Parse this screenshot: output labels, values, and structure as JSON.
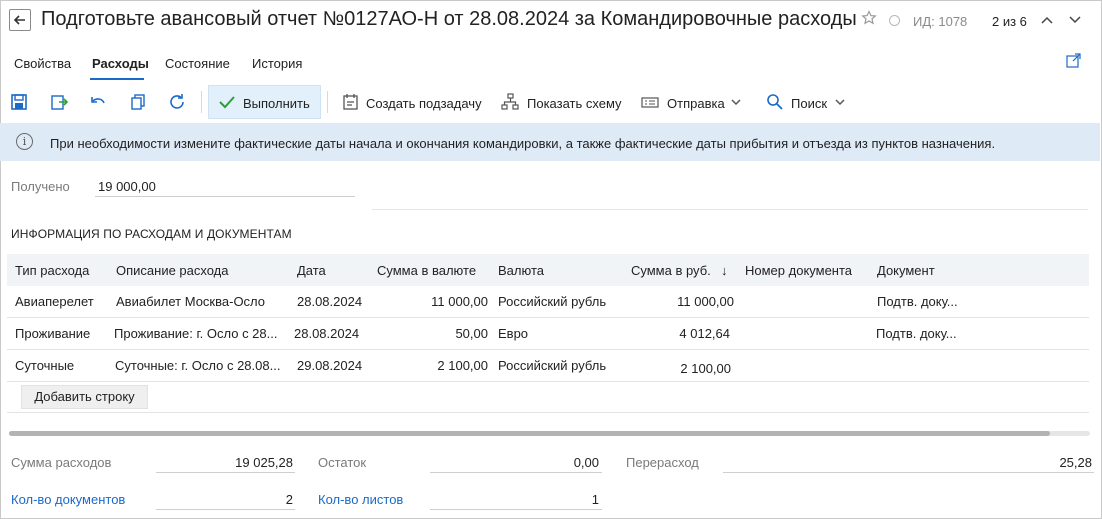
{
  "header": {
    "title": "Подготовьте авансовый отчет №0127АО-Н от 28.08.2024 за Командировочные расходы",
    "id_label": "ИД: 1078",
    "pager": "2 из 6"
  },
  "tabs": [
    {
      "label": "Свойства"
    },
    {
      "label": "Расходы"
    },
    {
      "label": "Состояние"
    },
    {
      "label": "История"
    }
  ],
  "toolbar": {
    "execute_label": "Выполнить",
    "create_subtask_label": "Создать подзадачу",
    "show_scheme_label": "Показать схему",
    "send_label": "Отправка",
    "search_label": "Поиск"
  },
  "info": {
    "text": "При необходимости измените фактические даты начала и окончания командировки, а также фактические даты прибытия и отъезда из пунктов назначения."
  },
  "received": {
    "label": "Получено",
    "value": "19 000,00"
  },
  "section_title": "ИНФОРМАЦИЯ ПО РАСХОДАМ И ДОКУМЕНТАМ",
  "table": {
    "columns": [
      "Тип расхода",
      "Описание расхода",
      "Дата",
      "Сумма в валюте",
      "Валюта",
      "Сумма в руб.",
      "Номер документа",
      "Документ"
    ],
    "sort_indicator": "↓",
    "rows": [
      [
        "Авиаперелет",
        "Авиабилет Москва-Осло",
        "28.08.2024",
        "11 000,00",
        "Российский рубль",
        "11 000,00",
        "",
        "Подтв. доку..."
      ],
      [
        "Проживание",
        "Проживание: г. Осло с 28...",
        "28.08.2024",
        "50,00",
        "Евро",
        "4 012,64",
        "",
        "Подтв. доку..."
      ],
      [
        "Суточные",
        "Суточные: г. Осло с 28.08...",
        "29.08.2024",
        "2 100,00",
        "Российский рубль",
        "2 100,00",
        "",
        ""
      ]
    ],
    "add_row_label": "Добавить строку"
  },
  "summary": {
    "expenses_label": "Сумма расходов",
    "expenses_value": "19 025,28",
    "remainder_label": "Остаток",
    "remainder_value": "0,00",
    "overspend_label": "Перерасход",
    "overspend_value": "25,28",
    "docs_label": "Кол-во документов",
    "docs_value": "2",
    "sheets_label": "Кол-во листов",
    "sheets_value": "1"
  },
  "colors": {
    "accent": "#1b6ac9",
    "info_bg": "#dfeaf7",
    "execute_bg": "#e2f0fb",
    "check_green": "#2e9e3a"
  }
}
